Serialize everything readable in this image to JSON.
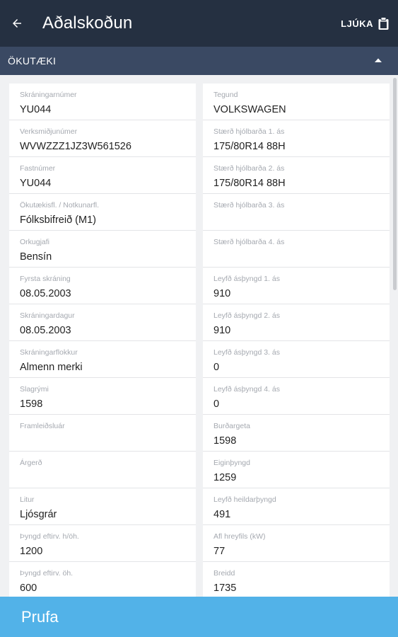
{
  "appbar": {
    "title": "Aðalskoðun",
    "finish_label": "LJÚKA"
  },
  "section": {
    "title": "ÖKUTÆKI"
  },
  "fields_left": [
    {
      "label": "Skráningarnúmer",
      "value": "YU044"
    },
    {
      "label": "Verksmiðjunúmer",
      "value": "WVWZZZ1JZ3W561526"
    },
    {
      "label": "Fastnúmer",
      "value": "YU044"
    },
    {
      "label": "Ökutækisfl. / Notkunarfl.",
      "value": "Fólksbifreið (M1)"
    },
    {
      "label": "Orkugjafi",
      "value": "Bensín"
    },
    {
      "label": "Fyrsta skráning",
      "value": "08.05.2003"
    },
    {
      "label": "Skráningardagur",
      "value": "08.05.2003"
    },
    {
      "label": "Skráningarflokkur",
      "value": "Almenn merki"
    },
    {
      "label": "Slagrými",
      "value": "1598"
    },
    {
      "label": "Framleiðsluár",
      "value": ""
    },
    {
      "label": "Árgerð",
      "value": ""
    },
    {
      "label": "Litur",
      "value": "Ljósgrár"
    },
    {
      "label": "Þyngd eftirv. h/öh.",
      "value": "1200"
    },
    {
      "label": "Þyngd eftirv. öh.",
      "value": "600"
    }
  ],
  "fields_right": [
    {
      "label": "Tegund",
      "value": "VOLKSWAGEN"
    },
    {
      "label": "Stærð hjólbarða 1. ás",
      "value": "175/80R14 88H"
    },
    {
      "label": "Stærð hjólbarða 2. ás",
      "value": "175/80R14 88H"
    },
    {
      "label": "Stærð hjólbarða 3. ás",
      "value": ""
    },
    {
      "label": "Stærð hjólbarða 4. ás",
      "value": ""
    },
    {
      "label": "Leyfð ásþyngd 1. ás",
      "value": "910"
    },
    {
      "label": "Leyfð ásþyngd 2. ás",
      "value": "910"
    },
    {
      "label": "Leyfð ásþyngd 3. ás",
      "value": "0"
    },
    {
      "label": "Leyfð ásþyngd 4. ás",
      "value": "0"
    },
    {
      "label": "Burðargeta",
      "value": "1598"
    },
    {
      "label": "Eiginþyngd",
      "value": "1259"
    },
    {
      "label": "Leyfð heildarþyngd",
      "value": "491"
    },
    {
      "label": "Afl hreyfils (kW)",
      "value": "77"
    },
    {
      "label": "Breidd",
      "value": "1735"
    }
  ],
  "bottom": {
    "label": "Prufa"
  },
  "colors": {
    "appbar": "#253041",
    "section_header": "#3a4963",
    "bottom_bar": "#52b2e8"
  },
  "icons": {
    "back": "arrow-left-icon",
    "finish": "clipboard-icon",
    "collapse": "chevron-up-icon"
  }
}
